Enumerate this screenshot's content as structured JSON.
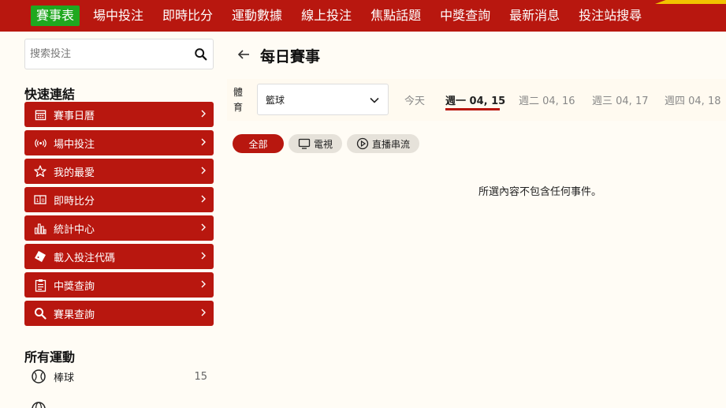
{
  "topnav": {
    "items": [
      "賽事表",
      "場中投注",
      "即時比分",
      "運動數據",
      "線上投注",
      "焦點話題",
      "中獎查詢",
      "最新消息",
      "投注站搜尋"
    ],
    "active_color": "#1fa81f",
    "bar_color": "#b8170f"
  },
  "sidebar": {
    "search_placeholder": "搜索投注",
    "quick_links_title": "快速連結",
    "quick_links": [
      {
        "label": "賽事日曆",
        "icon": "calendar-icon"
      },
      {
        "label": "場中投注",
        "icon": "broadcast-icon"
      },
      {
        "label": "我的最愛",
        "icon": "star-icon"
      },
      {
        "label": "即時比分",
        "icon": "scoreboard-icon"
      },
      {
        "label": "統計中心",
        "icon": "bar-chart-icon"
      },
      {
        "label": "載入投注代碼",
        "icon": "ticket-icon"
      },
      {
        "label": "中獎查詢",
        "icon": "clipboard-icon"
      },
      {
        "label": "賽果查詢",
        "icon": "search-icon"
      }
    ],
    "all_sports_title": "所有運動",
    "sports": [
      {
        "label": "棒球",
        "count": "15",
        "icon": "baseball-icon"
      }
    ]
  },
  "main": {
    "title": "每日賽事",
    "sport_label": "體育",
    "sport_selected": "籃球",
    "date_tabs": [
      "今天",
      "週一 04, 15",
      "週二 04, 16",
      "週三 04, 17",
      "週四 04, 18"
    ],
    "active_date_index": 1,
    "chips": [
      "全部",
      "電視",
      "直播串流"
    ],
    "empty_message": "所選內容不包含任何事件。"
  }
}
